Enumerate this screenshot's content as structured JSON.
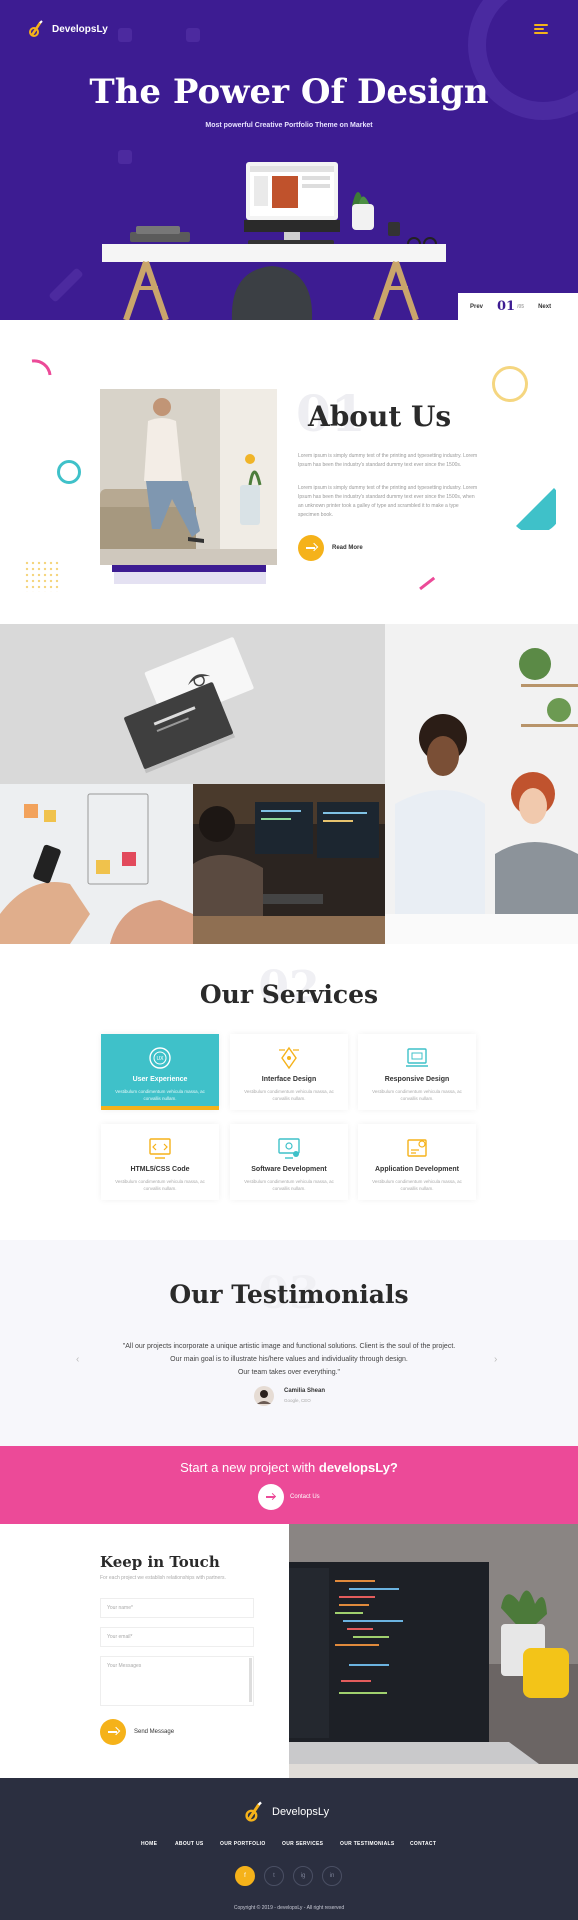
{
  "brand": {
    "name": "DevelopsLy",
    "accent": "#f5b21a",
    "purple": "#3d1c92",
    "teal": "#3fc1c9",
    "pink": "#ec4a98"
  },
  "hero": {
    "title": "The Power Of Design",
    "subtitle": "Most powerful Creative Portfolio Theme on Market",
    "slider": {
      "prev": "Prev",
      "current": "01",
      "total": "/05",
      "next": "Next"
    }
  },
  "about": {
    "title": "About Us",
    "bg_number": "01",
    "para1": "Lorem ipsum is simply dummy text of the printing and typesetting industry. Lorem Ipsum has been the industry's standard dummy text ever since the 1500s.",
    "para2": "Lorem ipsum is simply dummy text of the printing and typesetting industry. Lorem Ipsum has been the industry's standard dummy text ever since the 1500s, when an unknown printer took a galley of type and scrambled it to make a type specimen book.",
    "button_label": "Read More"
  },
  "services": {
    "title": "Our Services",
    "bg_number": "02",
    "items": [
      {
        "title": "User Experience",
        "desc": "Vestibulum condimentum vehicula massa, ac convallis nullam.",
        "icon": "ux-icon"
      },
      {
        "title": "Interface Design",
        "desc": "Vestibulum condimentum vehicula massa, ac convallis nullam.",
        "icon": "pen-tool-icon"
      },
      {
        "title": "Responsive Design",
        "desc": "Vestibulum condimentum vehicula massa, ac convallis nullam.",
        "icon": "devices-icon"
      },
      {
        "title": "HTML5/CSS Code",
        "desc": "Vestibulum condimentum vehicula massa, ac convallis nullam.",
        "icon": "code-icon"
      },
      {
        "title": "Software Development",
        "desc": "Vestibulum condimentum vehicula massa, ac convallis nullam.",
        "icon": "monitor-gear-icon"
      },
      {
        "title": "Application Development",
        "desc": "Vestibulum condimentum vehicula massa, ac convallis nullam.",
        "icon": "app-dev-icon"
      }
    ]
  },
  "testimonials": {
    "title": "Our Testimonials",
    "bg_number": "03",
    "quote_line1": "\"All our projects incorporate a unique artistic image and functional solutions. Client is the soul of the project.",
    "quote_line2": "Our main goal is to illustrate his/here values and individuality through design.",
    "quote_line3": "Our team takes over everything.\"",
    "author": "Camilia Shean",
    "author_role": "Google, CEO"
  },
  "cta": {
    "text_prefix": "Start a new project with ",
    "text_brand": "developsLy?",
    "button_label": "Contact Us"
  },
  "contact": {
    "title": "Keep in Touch",
    "subtitle": "For each project we establish relationships with partners.",
    "name_placeholder": "Your name*",
    "email_placeholder": "Your email*",
    "message_placeholder": "Your Messages",
    "button_label": "Send Message"
  },
  "footer": {
    "brand": "DevelopsLy",
    "nav": [
      "HOME",
      "ABOUT US",
      "OUR PORTFOLIO",
      "OUR SERVICES",
      "OUR TESTIMONIALS",
      "CONTACT"
    ],
    "social": [
      "f",
      "t",
      "ig",
      "in"
    ],
    "copyright": "Copyright © 2019 - developsLy - All right reserved"
  }
}
